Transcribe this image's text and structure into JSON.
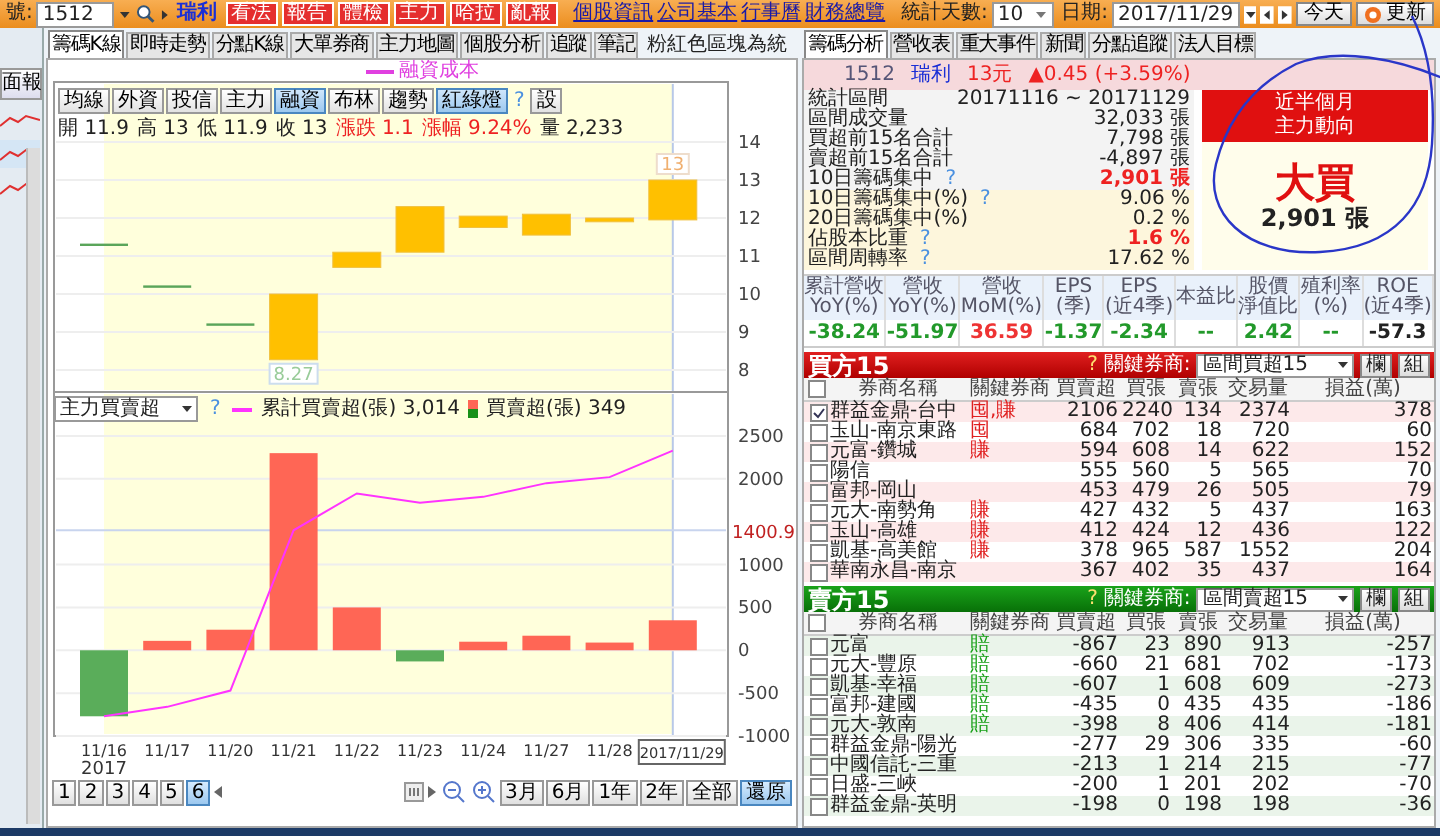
{
  "toolbar": {
    "code_label": "號:",
    "code": "1512",
    "name": "瑞利",
    "buttons": [
      "看法",
      "報告",
      "體檢",
      "主力",
      "哈拉",
      "亂報"
    ],
    "links": [
      "個股資訊",
      "公司基本",
      "行事曆",
      "財務總覽"
    ]
  },
  "right_toolbar": {
    "days_label": "統計天數:",
    "days": "10",
    "date_label": "日期:",
    "date": "2017/11/29",
    "today": "今天",
    "refresh": "更新"
  },
  "side_panel": {
    "button": "面報"
  },
  "left_tabs": [
    {
      "label": "籌碼K線",
      "selected": true
    },
    {
      "label": "即時走勢",
      "selected": false
    },
    {
      "label": "分點K線",
      "selected": false
    },
    {
      "label": "大單券商",
      "selected": false
    },
    {
      "label": "主力地圖",
      "selected": false
    },
    {
      "label": "個股分析",
      "selected": false
    },
    {
      "label": "追蹤",
      "selected": false
    },
    {
      "label": "筆記",
      "selected": false
    }
  ],
  "chart_note": "粉紅色區塊為統",
  "legend": "融資成本",
  "chart_buttons": [
    {
      "label": "均線",
      "selected": false
    },
    {
      "label": "外資",
      "selected": false
    },
    {
      "label": "投信",
      "selected": false
    },
    {
      "label": "主力",
      "selected": false
    },
    {
      "label": "融資",
      "selected": true
    },
    {
      "label": "布林",
      "selected": false
    },
    {
      "label": "趨勢",
      "selected": false
    },
    {
      "label": "紅綠燈",
      "selected": true
    }
  ],
  "chart_help": "?",
  "settings_button": "設",
  "quote": [
    {
      "label": "開",
      "value": "11.9",
      "highlighted": false
    },
    {
      "label": "高",
      "value": "13",
      "highlighted": false
    },
    {
      "label": "低",
      "value": "11.9",
      "highlighted": false
    },
    {
      "label": "收",
      "value": "13",
      "highlighted": false
    },
    {
      "label": "漲跌",
      "value": "1.1",
      "highlighted": true
    },
    {
      "label": "漲幅",
      "value": "9.24%",
      "highlighted": true
    },
    {
      "label": "量",
      "value": "2,233",
      "highlighted": false
    }
  ],
  "price_chart": {
    "yticks": [
      "14",
      "13",
      "12",
      "11",
      "10",
      "9",
      "8"
    ],
    "low_label": "8.27",
    "close_label": "13"
  },
  "flow_chart": {
    "selector": "主力買賣超",
    "help": "?",
    "legend_values": [
      "3,014",
      "349"
    ],
    "year": "2017",
    "cursor_value": "1400.9",
    "chart_data": {
      "type": "bar",
      "categories": [
        "11/16",
        "11/17",
        "11/20",
        "11/21",
        "11/22",
        "11/23",
        "11/24",
        "11/27",
        "11/28",
        "2017/11/29"
      ],
      "series": [
        {
          "name": "累計買賣超(張)",
          "type": "line",
          "color": "#ff33ff",
          "values": [
            -770,
            -660,
            -470,
            1400,
            1830,
            1720,
            1790,
            1950,
            2020,
            2330
          ]
        },
        {
          "name": "買賣超(張)",
          "type": "bar",
          "color": "#ff6655",
          "values": [
            null,
            110,
            240,
            2300,
            500,
            null,
            100,
            170,
            90,
            350
          ]
        },
        {
          "type": "bar",
          "color": "#5aad5a",
          "values": [
            -770,
            null,
            null,
            null,
            null,
            -130,
            null,
            null,
            null,
            null
          ]
        }
      ],
      "ylim": [
        -1000,
        2500
      ],
      "grid": true,
      "yticks": [
        -1000,
        -500,
        0,
        500,
        1000,
        2000,
        2500
      ]
    }
  },
  "pager": {
    "pages": [
      {
        "label": "1",
        "selected": false
      },
      {
        "label": "2",
        "selected": false
      },
      {
        "label": "3",
        "selected": false
      },
      {
        "label": "4",
        "selected": false
      },
      {
        "label": "5",
        "selected": false
      },
      {
        "label": "6",
        "selected": true
      }
    ],
    "ranges": [
      {
        "label": "3月",
        "selected": false
      },
      {
        "label": "6月",
        "selected": false
      },
      {
        "label": "1年",
        "selected": false
      },
      {
        "label": "2年",
        "selected": false
      },
      {
        "label": "全部",
        "selected": false
      },
      {
        "label": "還原",
        "selected": true
      }
    ]
  },
  "right_tabs": [
    {
      "label": "籌碼分析",
      "selected": true
    },
    {
      "label": "營收表",
      "selected": false
    },
    {
      "label": "重大事件",
      "selected": false
    },
    {
      "label": "新聞",
      "selected": false
    },
    {
      "label": "分點追蹤",
      "selected": false
    },
    {
      "label": "法人目標",
      "selected": false
    }
  ],
  "stock_header": {
    "code": "1512",
    "name": "瑞利",
    "price": "13元",
    "change": "▲0.45 (+3.59%)"
  },
  "stats": [
    {
      "label": "統計區間",
      "value": "20171116 ~ 20171129",
      "highlighted": false,
      "band": false
    },
    {
      "label": "區間成交量",
      "value": "32,033 張",
      "highlighted": false,
      "band": false
    },
    {
      "label": "買超前15名合計",
      "value": "7,798 張",
      "highlighted": false,
      "band": false
    },
    {
      "label": "賣超前15名合計",
      "value": "-4,897 張",
      "highlighted": false,
      "band": false
    },
    {
      "label": "10日籌碼集中",
      "help": "?",
      "value": "2,901 張",
      "highlighted": true,
      "band": false
    },
    {
      "label": "10日籌碼集中(%)",
      "help": "?",
      "value": "9.06 %",
      "highlighted": false,
      "band": true
    },
    {
      "label": "20日籌碼集中(%)",
      "value": "0.2 %",
      "highlighted": false,
      "band": true
    },
    {
      "label": "佔股本比重",
      "help": "?",
      "value": "1.6 %",
      "highlighted": true,
      "band": true
    },
    {
      "label": "區間周轉率",
      "help": "?",
      "value": "17.62 %",
      "highlighted": false,
      "band": true
    }
  ],
  "trend_box": {
    "title": "近半個月",
    "subtitle": "主力動向",
    "verdict": "大買",
    "amount": "2,901 張"
  },
  "metrics": [
    {
      "label": "累計營收",
      "unit": "YoY(%)",
      "value": "-38.24",
      "color": "#22992a"
    },
    {
      "label": "營收",
      "unit": "YoY(%)",
      "value": "-51.97",
      "color": "#22992a"
    },
    {
      "label": "營收",
      "unit": "MoM(%)",
      "value": "36.59",
      "color": "#ee3333"
    },
    {
      "label": "EPS",
      "unit": "(季)",
      "value": "-1.37",
      "color": "#22992a"
    },
    {
      "label": "EPS",
      "unit": "(近4季)",
      "value": "-2.34",
      "color": "#22992a"
    },
    {
      "label": "本益比",
      "value": "--",
      "color": "#22992a"
    },
    {
      "label": "股價",
      "unit": "淨值比",
      "value": "2.42",
      "color": "#22992a"
    },
    {
      "label": "殖利率",
      "unit": "(%)",
      "value": "--",
      "color": "#22992a"
    },
    {
      "label": "ROE",
      "unit": "(近4季)",
      "value": "-57.3",
      "color": "#222222"
    }
  ],
  "buy_table": {
    "kind": "buy",
    "title": "買方15",
    "help": "?",
    "key_label": "關鍵券商:",
    "filter": "區間買超15",
    "buttons": [
      "欄",
      "組"
    ],
    "all_checked": false,
    "columns": [
      "券商名稱",
      "關鍵券商",
      "買賣超",
      "買張",
      "賣張",
      "交易量",
      "損益(萬)"
    ],
    "rows": [
      {
        "checked": true,
        "cells": [
          "群益金鼎-台中",
          "囤,賺",
          "2106",
          "2240",
          "134",
          "2374",
          "378"
        ]
      },
      {
        "checked": false,
        "cells": [
          "玉山-南京東路",
          "囤",
          "684",
          "702",
          "18",
          "720",
          "60"
        ]
      },
      {
        "checked": false,
        "cells": [
          "元富-鑽城",
          "賺",
          "594",
          "608",
          "14",
          "622",
          "152"
        ]
      },
      {
        "checked": false,
        "cells": [
          "陽信",
          "",
          "555",
          "560",
          "5",
          "565",
          "70"
        ]
      },
      {
        "checked": false,
        "cells": [
          "富邦-岡山",
          "",
          "453",
          "479",
          "26",
          "505",
          "79"
        ]
      },
      {
        "checked": false,
        "cells": [
          "元大-南勢角",
          "賺",
          "427",
          "432",
          "5",
          "437",
          "163"
        ]
      },
      {
        "checked": false,
        "cells": [
          "玉山-高雄",
          "賺",
          "412",
          "424",
          "12",
          "436",
          "122"
        ]
      },
      {
        "checked": false,
        "cells": [
          "凱基-高美館",
          "賺",
          "378",
          "965",
          "587",
          "1552",
          "204"
        ]
      },
      {
        "checked": false,
        "cells": [
          "華南永昌-南京",
          "",
          "367",
          "402",
          "35",
          "437",
          "164"
        ]
      }
    ]
  },
  "sell_table": {
    "kind": "sell",
    "title": "賣方15",
    "help": "?",
    "key_label": "關鍵券商:",
    "filter": "區間賣超15",
    "buttons": [
      "欄",
      "組"
    ],
    "all_checked": false,
    "columns": [
      "券商名稱",
      "關鍵券商",
      "買賣超",
      "買張",
      "賣張",
      "交易量",
      "損益(萬)"
    ],
    "rows": [
      {
        "checked": false,
        "cells": [
          "元富",
          "賠",
          "-867",
          "23",
          "890",
          "913",
          "-257"
        ]
      },
      {
        "checked": false,
        "cells": [
          "元大-豐原",
          "賠",
          "-660",
          "21",
          "681",
          "702",
          "-173"
        ]
      },
      {
        "checked": false,
        "cells": [
          "凱基-幸福",
          "賠",
          "-607",
          "1",
          "608",
          "609",
          "-273"
        ]
      },
      {
        "checked": false,
        "cells": [
          "富邦-建國",
          "賠",
          "-435",
          "0",
          "435",
          "435",
          "-186"
        ]
      },
      {
        "checked": false,
        "cells": [
          "元大-敦南",
          "賠",
          "-398",
          "8",
          "406",
          "414",
          "-181"
        ]
      },
      {
        "checked": false,
        "cells": [
          "群益金鼎-陽光",
          "",
          "-277",
          "29",
          "306",
          "335",
          "-60"
        ]
      },
      {
        "checked": false,
        "cells": [
          "中國信託-三重",
          "",
          "-213",
          "1",
          "214",
          "215",
          "-77"
        ]
      },
      {
        "checked": false,
        "cells": [
          "日盛-三峽",
          "",
          "-200",
          "1",
          "201",
          "202",
          "-70"
        ]
      },
      {
        "checked": false,
        "cells": [
          "群益金鼎-英明",
          "",
          "-198",
          "0",
          "198",
          "198",
          "-36"
        ]
      }
    ]
  }
}
